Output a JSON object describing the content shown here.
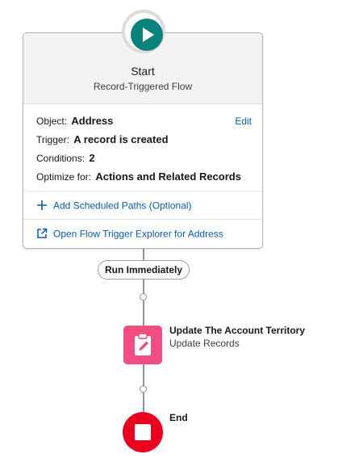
{
  "start": {
    "title": "Start",
    "subtitle": "Record-Triggered Flow",
    "object_label": "Object:",
    "object_value": "Address",
    "edit_label": "Edit",
    "trigger_label": "Trigger:",
    "trigger_value": "A record is created",
    "conditions_label": "Conditions:",
    "conditions_value": "2",
    "optimize_label": "Optimize for:",
    "optimize_value": "Actions and Related Records",
    "add_scheduled_paths": "Add Scheduled Paths (Optional)",
    "open_explorer": "Open Flow Trigger Explorer for Address"
  },
  "path_label": "Run Immediately",
  "action": {
    "title": "Update The Account Territory",
    "subtitle": "Update Records"
  },
  "end": {
    "label": "End"
  },
  "colors": {
    "start_accent": "#0b827c",
    "action_accent": "#f04e80",
    "end_accent": "#ea001e",
    "link": "#0b5cab"
  },
  "icons": [
    "play-icon",
    "plus-icon",
    "external-link-icon",
    "clipboard-edit-icon",
    "stop-icon"
  ]
}
